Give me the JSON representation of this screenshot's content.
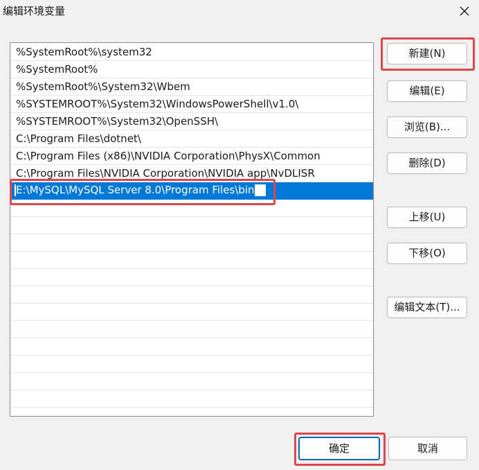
{
  "window": {
    "title": "编辑环境变量"
  },
  "icons": {
    "close": "close-icon"
  },
  "paths": [
    "%SystemRoot%\\system32",
    "%SystemRoot%",
    "%SystemRoot%\\System32\\Wbem",
    "%SYSTEMROOT%\\System32\\WindowsPowerShell\\v1.0\\",
    "%SYSTEMROOT%\\System32\\OpenSSH\\",
    "C:\\Program Files\\dotnet\\",
    "C:\\Program Files (x86)\\NVIDIA Corporation\\PhysX\\Common",
    "C:\\Program Files\\NVIDIA Corporation\\NVIDIA app\\NvDLISR"
  ],
  "editing_value": "E:\\MySQL\\MySQL Server 8.0\\Program Files\\bin",
  "buttons": {
    "new": "新建(N)",
    "edit": "编辑(E)",
    "browse": "浏览(B)...",
    "delete": "删除(D)",
    "move_up": "上移(U)",
    "move_down": "下移(O)",
    "edit_text": "编辑文本(T)...",
    "ok": "确定",
    "cancel": "取消"
  },
  "colors": {
    "highlight": "#e0454b",
    "selection": "#0078d7",
    "primary_border": "#0067c0"
  }
}
